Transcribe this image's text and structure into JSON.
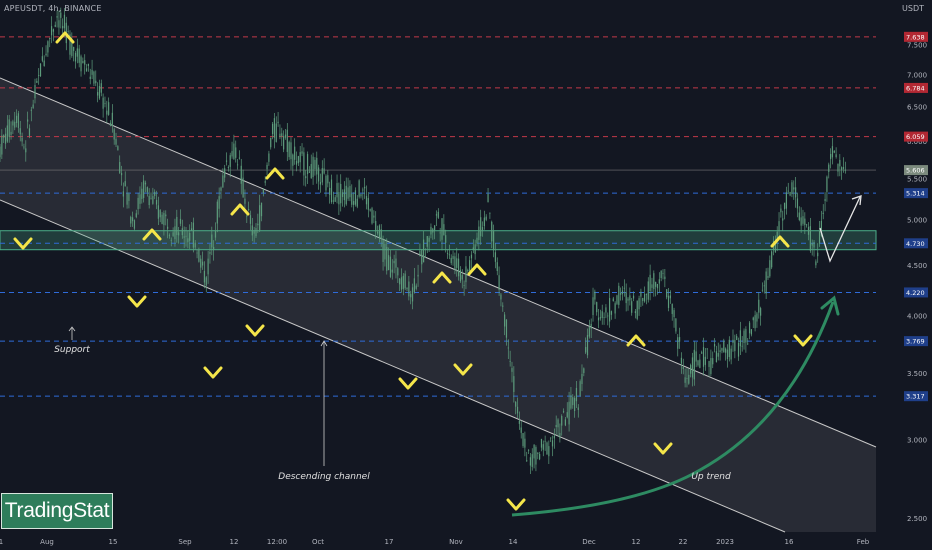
{
  "header": {
    "ticker": "APEUSDT, 4h, BINANCE",
    "currency": "USDT"
  },
  "watermark": {
    "text": "TradingStat"
  },
  "colors": {
    "background": "#131722",
    "candles": "#5d9c7c",
    "red_levels": "#c2384a",
    "blue_levels": "#2f6bd8",
    "support_zone": "#4caf8a",
    "marker": "#f5e64a",
    "curve": "#2e8b62",
    "channel_line": "#c8c8c8"
  },
  "chart_data": {
    "type": "candlestick",
    "ylim": [
      2.42,
      8.32
    ],
    "scale": "log",
    "x_ticks": [
      "1",
      "Aug",
      "15",
      "Sep",
      "12",
      "12:00",
      "Oct",
      "17",
      "Nov",
      "14",
      "Dec",
      "12",
      "22",
      "2023",
      "16",
      "Feb"
    ],
    "y_ticks": [
      "2.500",
      "3.000",
      "3.500",
      "4.000",
      "4.500",
      "5.000",
      "5.500",
      "6.000",
      "6.500",
      "7.000",
      "7.500"
    ],
    "price_tags": [
      {
        "label": "7.638",
        "kind": "red"
      },
      {
        "label": "6.784",
        "kind": "red"
      },
      {
        "label": "6.059",
        "kind": "red"
      },
      {
        "label": "5.606",
        "kind": "current"
      },
      {
        "label": "5.314",
        "kind": "blue"
      },
      {
        "label": "4.730",
        "kind": "blue"
      },
      {
        "label": "4.220",
        "kind": "blue"
      },
      {
        "label": "3.769",
        "kind": "blue"
      },
      {
        "label": "3.317",
        "kind": "blue"
      }
    ],
    "levels": [
      {
        "value": 7.638,
        "style": "red-dashed"
      },
      {
        "value": 6.784,
        "style": "red-dashed"
      },
      {
        "value": 6.059,
        "style": "red-dashed"
      },
      {
        "value": 5.314,
        "style": "blue-dashed"
      },
      {
        "value": 4.73,
        "style": "blue-dashed"
      },
      {
        "value": 4.22,
        "style": "blue-dashed"
      },
      {
        "value": 3.769,
        "style": "blue-dashed"
      },
      {
        "value": 3.317,
        "style": "blue-dashed"
      }
    ],
    "support_zone": {
      "from": 4.66,
      "to": 4.87
    },
    "price_path": [
      [
        0,
        5.9
      ],
      [
        0.02,
        6.4
      ],
      [
        0.028,
        5.9
      ],
      [
        0.048,
        7.2
      ],
      [
        0.065,
        8.05
      ],
      [
        0.082,
        7.5
      ],
      [
        0.1,
        7.1
      ],
      [
        0.118,
        6.6
      ],
      [
        0.13,
        6.2
      ],
      [
        0.14,
        5.5
      ],
      [
        0.152,
        5.0
      ],
      [
        0.165,
        5.4
      ],
      [
        0.18,
        5.1
      ],
      [
        0.2,
        4.9
      ],
      [
        0.222,
        4.8
      ],
      [
        0.235,
        4.35
      ],
      [
        0.245,
        4.9
      ],
      [
        0.258,
        5.7
      ],
      [
        0.27,
        5.9
      ],
      [
        0.28,
        5.2
      ],
      [
        0.29,
        4.78
      ],
      [
        0.3,
        5.2
      ],
      [
        0.31,
        6.1
      ],
      [
        0.32,
        6.2
      ],
      [
        0.338,
        5.75
      ],
      [
        0.36,
        5.6
      ],
      [
        0.38,
        5.35
      ],
      [
        0.4,
        5.3
      ],
      [
        0.415,
        5.35
      ],
      [
        0.428,
        4.95
      ],
      [
        0.442,
        4.55
      ],
      [
        0.458,
        4.4
      ],
      [
        0.47,
        4.2
      ],
      [
        0.482,
        4.6
      ],
      [
        0.5,
        5.05
      ],
      [
        0.515,
        4.6
      ],
      [
        0.53,
        4.35
      ],
      [
        0.545,
        4.8
      ],
      [
        0.558,
        5.15
      ],
      [
        0.57,
        4.3
      ],
      [
        0.582,
        3.7
      ],
      [
        0.592,
        3.1
      ],
      [
        0.605,
        2.85
      ],
      [
        0.62,
        2.93
      ],
      [
        0.635,
        3.05
      ],
      [
        0.65,
        3.2
      ],
      [
        0.662,
        3.35
      ],
      [
        0.678,
        4.1
      ],
      [
        0.692,
        4.0
      ],
      [
        0.708,
        4.2
      ],
      [
        0.728,
        4.1
      ],
      [
        0.742,
        4.3
      ],
      [
        0.755,
        4.4
      ],
      [
        0.768,
        4.05
      ],
      [
        0.782,
        3.45
      ],
      [
        0.795,
        3.6
      ],
      [
        0.812,
        3.62
      ],
      [
        0.828,
        3.67
      ],
      [
        0.842,
        3.75
      ],
      [
        0.856,
        3.8
      ],
      [
        0.868,
        4.1
      ],
      [
        0.88,
        4.5
      ],
      [
        0.892,
        5.1
      ],
      [
        0.906,
        5.4
      ],
      [
        0.915,
        5.0
      ],
      [
        0.924,
        4.8
      ],
      [
        0.932,
        4.55
      ],
      [
        0.94,
        5.1
      ],
      [
        0.95,
        5.9
      ],
      [
        0.958,
        5.65
      ],
      [
        0.965,
        5.55
      ]
    ],
    "annotations": [
      {
        "text": "Support"
      },
      {
        "text": "Descending channel"
      },
      {
        "text": "Up trend"
      }
    ]
  }
}
